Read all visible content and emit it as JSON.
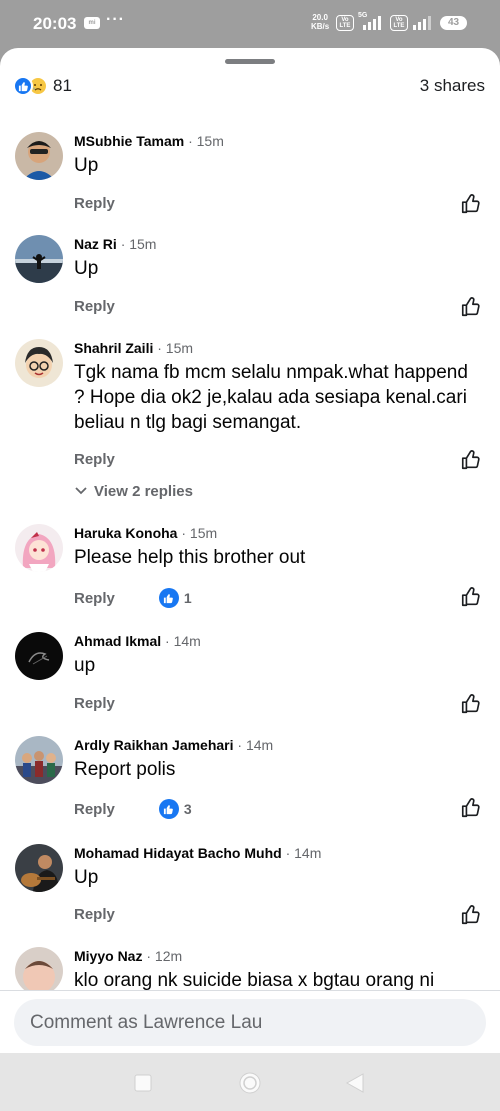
{
  "status_bar": {
    "time": "20:03",
    "mini_icon": "mi",
    "dots": "···",
    "net_speed_value": "20.0",
    "net_speed_unit": "KB/s",
    "volte_top": "Vo",
    "volte_bottom": "LTE",
    "network": "5G",
    "battery": "43"
  },
  "header": {
    "reaction_count": "81",
    "shares": "3 shares",
    "reactions": [
      "like-icon",
      "sad-icon"
    ]
  },
  "comments": [
    {
      "name": "MSubhie Tamam",
      "time": "· 15m",
      "text": "Up",
      "reply": "Reply"
    },
    {
      "name": "Naz Ri",
      "time": "· 15m",
      "text": "Up",
      "reply": "Reply"
    },
    {
      "name": "Shahril Zaili",
      "time": "· 15m",
      "text": "Tgk nama fb mcm selalu nmpak.what happend ? Hope dia ok2 je,kalau ada sesiapa kenal.cari beliau n tlg bagi semangat.",
      "reply": "Reply",
      "view_replies": "View 2 replies"
    },
    {
      "name": "Haruka Konoha",
      "time": "· 15m",
      "text": "Please help this brother out",
      "reply": "Reply",
      "likes": "1"
    },
    {
      "name": "Ahmad Ikmal",
      "time": "· 14m",
      "text": "up",
      "reply": "Reply"
    },
    {
      "name": "Ardly Raikhan Jamehari",
      "time": "· 14m",
      "text": "Report polis",
      "reply": "Reply",
      "likes": "3"
    },
    {
      "name": "Mohamad Hidayat Bacho Muhd",
      "time": "· 14m",
      "text": "Up",
      "reply": "Reply"
    },
    {
      "name": "Miyyo Naz",
      "time": "· 12m",
      "text": "klo orang nk suicide biasa x bgtau orang ni"
    }
  ],
  "composer": {
    "placeholder": "Comment as Lawrence Lau"
  },
  "colors": {
    "accent": "#1877f2",
    "secondary_text": "#65676b",
    "status_bar": "#9e9e9e"
  }
}
